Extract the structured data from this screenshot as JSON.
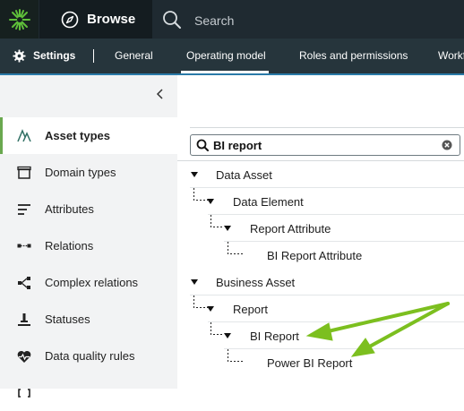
{
  "topbar": {
    "browse_label": "Browse",
    "search_placeholder": "Search"
  },
  "settings_bar": {
    "title": "Settings",
    "tabs": [
      {
        "label": "General"
      },
      {
        "label": "Operating model",
        "active": true
      },
      {
        "label": "Roles and permissions"
      },
      {
        "label": "Workf"
      }
    ]
  },
  "sidebar": {
    "items": [
      {
        "label": "Asset types",
        "icon": "asset-types-icon",
        "active": true
      },
      {
        "label": "Domain types",
        "icon": "domain-types-icon"
      },
      {
        "label": "Attributes",
        "icon": "attributes-icon"
      },
      {
        "label": "Relations",
        "icon": "relations-icon"
      },
      {
        "label": "Complex relations",
        "icon": "complex-relations-icon"
      },
      {
        "label": "Statuses",
        "icon": "statuses-icon"
      },
      {
        "label": "Data quality rules",
        "icon": "data-quality-icon"
      }
    ]
  },
  "filter": {
    "value": "BI report"
  },
  "tree": [
    {
      "label": "Data Asset",
      "level": 0,
      "expanded": true
    },
    {
      "label": "Data Element",
      "level": 1,
      "expanded": true
    },
    {
      "label": "Report Attribute",
      "level": 2,
      "expanded": true
    },
    {
      "label": "BI Report Attribute",
      "level": 3,
      "expanded": false
    },
    {
      "label": "Business Asset",
      "level": 0,
      "expanded": true
    },
    {
      "label": "Report",
      "level": 1,
      "expanded": true
    },
    {
      "label": "BI Report",
      "level": 2,
      "expanded": true
    },
    {
      "label": "Power BI Report",
      "level": 3,
      "expanded": false
    }
  ],
  "colors": {
    "accent_green": "#6aa84f",
    "annotation_arrow": "#7cbf1f",
    "topbar_bg": "#1f2a31",
    "tabbar_bg": "#26353c"
  }
}
